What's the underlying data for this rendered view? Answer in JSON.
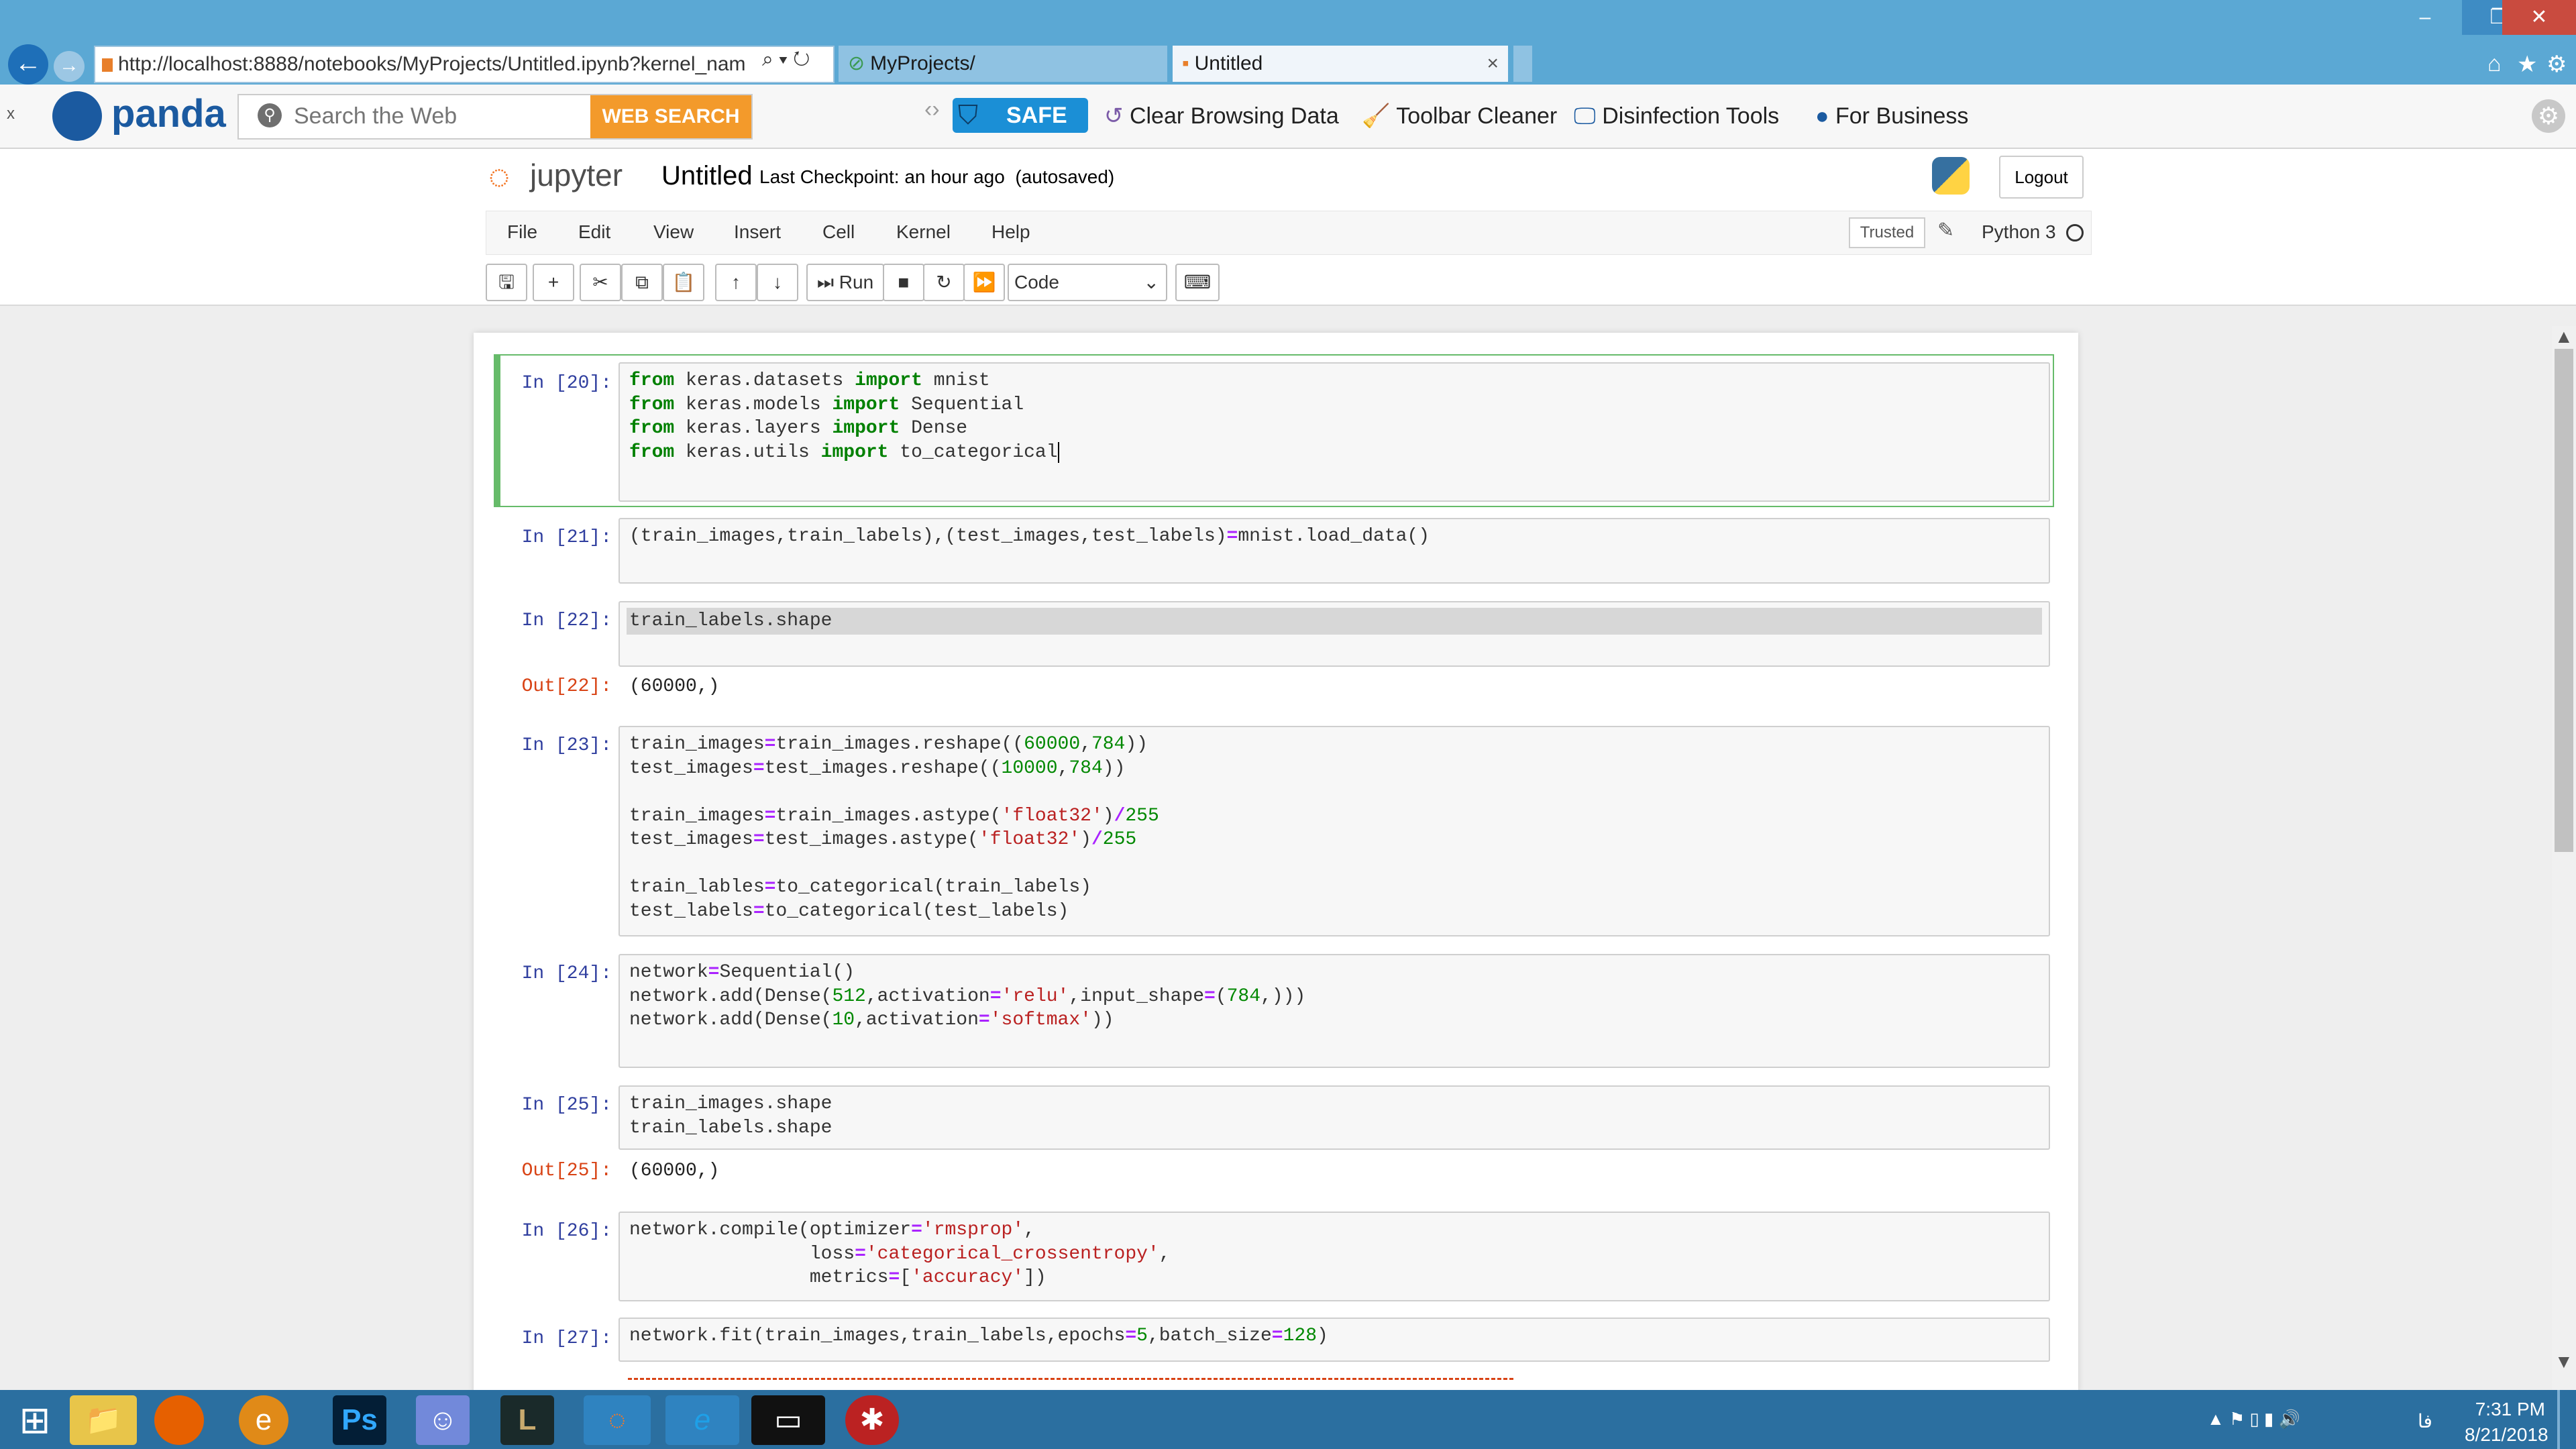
{
  "browser": {
    "url": "http://localhost:8888/notebooks/MyProjects/Untitled.ipynb?kernel_nam",
    "tabs": [
      {
        "title": "MyProjects/"
      },
      {
        "title": "Untitled"
      }
    ],
    "tab_close": "×"
  },
  "toolbar": {
    "brand": "panda",
    "search_placeholder": "Search the Web",
    "web_search_label": "WEB SEARCH",
    "safe_label": "SAFE",
    "clear_browsing": "Clear Browsing Data",
    "toolbar_cleaner": "Toolbar Cleaner",
    "disinfection_tools": "Disinfection Tools",
    "for_business": "For Business",
    "close_x": "x"
  },
  "jupyter": {
    "logo_text": "jupyter",
    "notebook_name": "Untitled",
    "checkpoint": "Last Checkpoint: an hour ago",
    "autosaved": "(autosaved)",
    "logout": "Logout",
    "trusted": "Trusted",
    "kernel": "Python 3",
    "menu": [
      "File",
      "Edit",
      "View",
      "Insert",
      "Cell",
      "Kernel",
      "Help"
    ],
    "run_label": "Run",
    "cell_type": "Code"
  },
  "cells": {
    "c20": {
      "prompt": "In [20]:"
    },
    "c21": {
      "prompt": "In [21]:"
    },
    "c22": {
      "prompt": "In [22]:",
      "out_prompt": "Out[22]:",
      "output": "(60000,)"
    },
    "c23": {
      "prompt": "In [23]:"
    },
    "c24": {
      "prompt": "In [24]:"
    },
    "c25": {
      "prompt": "In [25]:",
      "out_prompt": "Out[25]:",
      "output": "(60000,)"
    },
    "c26": {
      "prompt": "In [26]:"
    },
    "c27": {
      "prompt": "In [27]:"
    }
  },
  "code_lines": {
    "c20": [
      "from keras.datasets import mnist",
      "from keras.models import Sequential",
      "from keras.layers import Dense",
      "from keras.utils import to_categorical"
    ],
    "c21": [
      "(train_images,train_labels),(test_images,test_labels)=mnist.load_data()"
    ],
    "c22": [
      "train_labels.shape"
    ],
    "c23": [
      "train_images=train_images.reshape((60000,784))",
      "test_images=test_images.reshape((10000,784))",
      "",
      "train_images=train_images.astype('float32')/255",
      "test_images=test_images.astype('float32')/255",
      "",
      "train_lables=to_categorical(train_labels)",
      "test_labels=to_categorical(test_labels)"
    ],
    "c24": [
      "network=Sequential()",
      "network.add(Dense(512,activation='relu',input_shape=(784,)))",
      "network.add(Dense(10,activation='softmax'))"
    ],
    "c25": [
      "train_images.shape",
      "train_labels.shape"
    ],
    "c26": [
      "network.compile(optimizer='rmsprop',",
      "                loss='categorical_crossentropy',",
      "                metrics=['accuracy'])"
    ],
    "c27": [
      "network.fit(train_images,train_labels,epochs=5,batch_size=128)"
    ]
  },
  "taskbar": {
    "time": "7:31 PM",
    "date": "8/21/2018",
    "lang": "فا"
  },
  "colors": {
    "titlebar": "#5ba8d4",
    "selected_cell": "#66bb6a",
    "keyword": "#008000",
    "string": "#ba2121",
    "prompt_in": "#303f9f",
    "prompt_out": "#d84315"
  }
}
